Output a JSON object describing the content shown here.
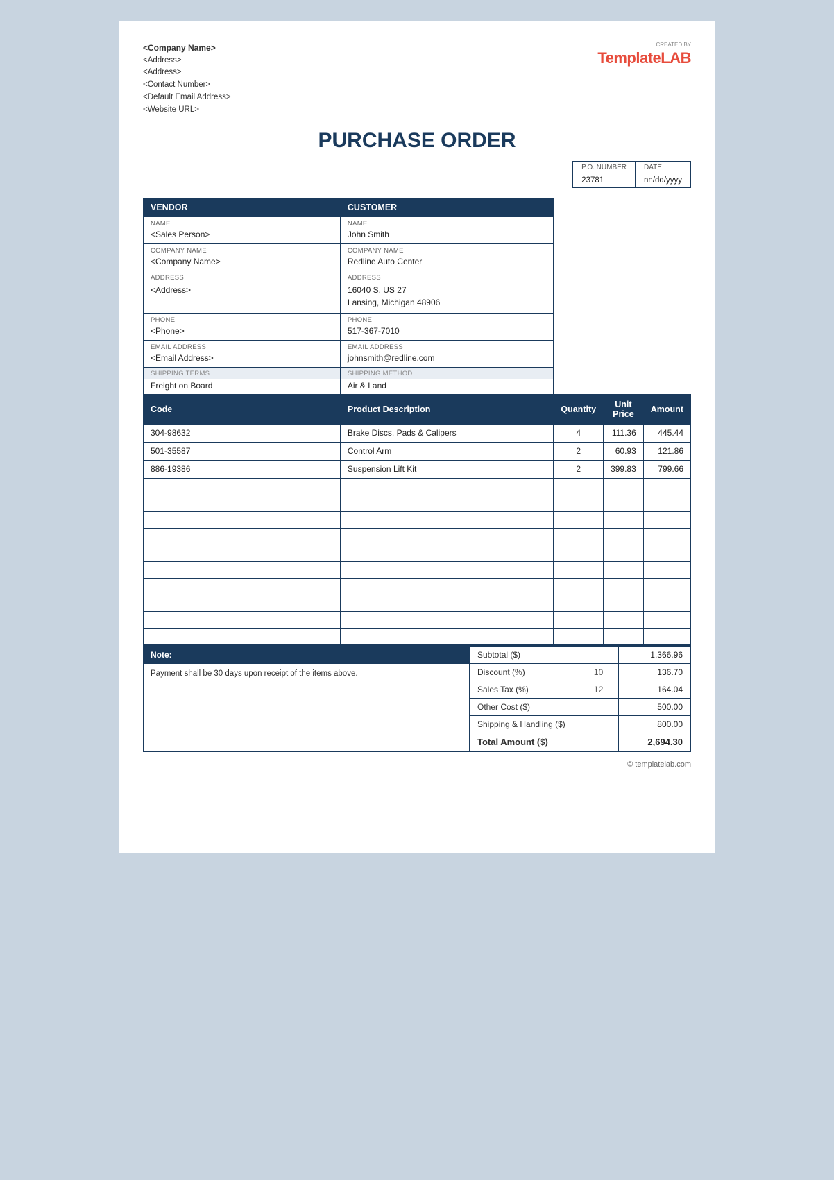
{
  "logo": {
    "created_by": "CREATED BY",
    "brand_template": "Template",
    "brand_lab": "LAB"
  },
  "company": {
    "name": "<Company Name>",
    "address1": "<Address>",
    "address2": "<Address>",
    "contact": "<Contact Number>",
    "email": "<Default Email Address>",
    "website": "<Website URL>"
  },
  "title": "PURCHASE ORDER",
  "po_number": {
    "label": "P.O. NUMBER",
    "value": "23781"
  },
  "date": {
    "label": "DATE",
    "value": "nn/dd/yyyy"
  },
  "vendor": {
    "section_label": "VENDOR",
    "name_label": "NAME",
    "name_value": "<Sales Person>",
    "company_label": "COMPANY NAME",
    "company_value": "<Company Name>",
    "address_label": "ADDRESS",
    "address_value": "<Address>",
    "phone_label": "PHONE",
    "phone_value": "<Phone>",
    "email_label": "EMAIL ADDRESS",
    "email_value": "<Email Address>"
  },
  "customer": {
    "section_label": "CUSTOMER",
    "name_label": "NAME",
    "name_value": "John Smith",
    "company_label": "COMPANY NAME",
    "company_value": "Redline Auto Center",
    "address_label": "ADDRESS",
    "address_line1": "16040 S. US 27",
    "address_line2": "Lansing, Michigan 48906",
    "phone_label": "PHONE",
    "phone_value": "517-367-7010",
    "email_label": "EMAIL ADDRESS",
    "email_value": "johnsmith@redline.com"
  },
  "shipping": {
    "terms_label": "SHIPPING TERMS",
    "terms_value": "Freight on Board",
    "method_label": "SHIPPING METHOD",
    "method_value": "Air & Land"
  },
  "table_headers": {
    "code": "Code",
    "description": "Product Description",
    "quantity": "Quantity",
    "unit_price": "Unit Price",
    "amount": "Amount"
  },
  "items": [
    {
      "code": "304-98632",
      "description": "Brake Discs, Pads & Calipers",
      "quantity": "4",
      "unit_price": "111.36",
      "amount": "445.44"
    },
    {
      "code": "501-35587",
      "description": "Control Arm",
      "quantity": "2",
      "unit_price": "60.93",
      "amount": "121.86"
    },
    {
      "code": "886-19386",
      "description": "Suspension Lift Kit",
      "quantity": "2",
      "unit_price": "399.83",
      "amount": "799.66"
    }
  ],
  "empty_rows": 10,
  "note": {
    "header": "Note:",
    "content": "Payment shall be 30 days upon receipt of the items above."
  },
  "totals": {
    "subtotal_label": "Subtotal ($)",
    "subtotal_value": "1,366.96",
    "discount_label": "Discount (%)",
    "discount_pct": "10",
    "discount_value": "136.70",
    "tax_label": "Sales Tax (%)",
    "tax_pct": "12",
    "tax_value": "164.04",
    "other_label": "Other Cost ($)",
    "other_value": "500.00",
    "shipping_label": "Shipping & Handling ($)",
    "shipping_value": "800.00",
    "total_label": "Total Amount ($)",
    "total_value": "2,694.30"
  },
  "footer": {
    "copyright": "© templatelab.com"
  }
}
